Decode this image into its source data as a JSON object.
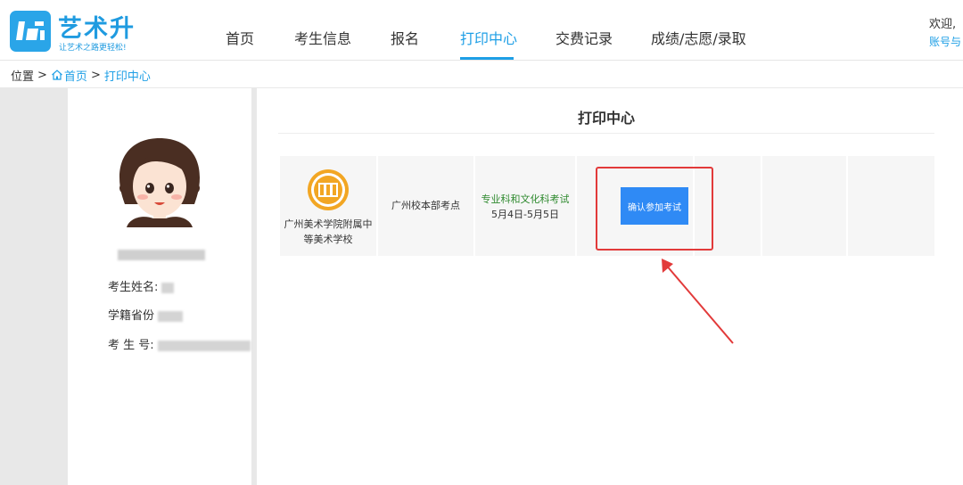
{
  "brand": {
    "name": "艺术升",
    "slogan": "让艺术之路更轻松!",
    "color": "#1f9be0"
  },
  "nav": {
    "items": [
      {
        "label": "首页"
      },
      {
        "label": "考生信息"
      },
      {
        "label": "报名"
      },
      {
        "label": "打印中心",
        "active": true
      },
      {
        "label": "交费记录"
      },
      {
        "label": "成绩/志愿/录取"
      }
    ],
    "accent": "#1e9fe6"
  },
  "user": {
    "welcome": "欢迎,",
    "account": "账号与"
  },
  "breadcrumb": {
    "prefix": "位置",
    "sep1": ">",
    "home": "首页",
    "sep2": ">",
    "current": "打印中心"
  },
  "profile": {
    "name_label": "考生姓名:",
    "province_label": "学籍省份",
    "exam_no_label": "考 生 号:"
  },
  "main": {
    "title": "打印中心",
    "row": {
      "school_name": "广州美术学院附属中等美术学校",
      "exam_point": "广州校本部考点",
      "subject": "专业科和文化科考试",
      "dates": "5月4日-5月5日",
      "button_label": "确认参加考试"
    }
  },
  "colors": {
    "highlight": "#e23a3a",
    "button": "#2f8af5",
    "subject_text": "#2f8a2f"
  }
}
